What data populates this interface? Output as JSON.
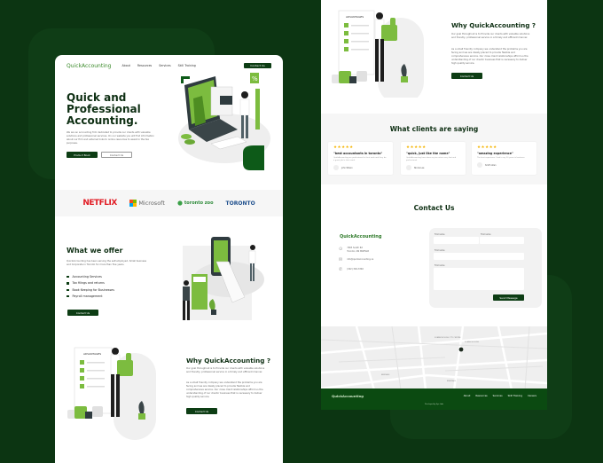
{
  "brand": "QuickAccounting",
  "nav": {
    "links": [
      "About",
      "Resources",
      "Services",
      "Skill Training"
    ],
    "contact_button": "Contact Us"
  },
  "hero": {
    "title": "Quick and Professional Accounting.",
    "paragraph": "We are an accounting firm dedicated to provide our clients with valuable solutions and professional services. On our website you will find information about our firm and external links to online resources to assist in the tax purposes.",
    "primary_button": "Product Book",
    "secondary_button": "Contact Us"
  },
  "clients_strip": {
    "logos": [
      "NETFLIX",
      "Microsoft",
      "toronto zoo",
      "TORONTO"
    ]
  },
  "offer": {
    "title": "What we offer",
    "paragraph": "QuickAccounting has been serving the self-employed, Small business and Corporate in Toronto for more than five years.",
    "items": [
      "Accounting Services",
      "Tax filings and returns",
      "Book Keeping for Businesses",
      "Payroll management"
    ],
    "button": "Contact Us"
  },
  "why": {
    "title": "Why QuickAccounting ?",
    "paragraph1": "Our goal throughout is to Provide our clients with valuable solutions and friendly, professional service in a timely and efficient manner.",
    "paragraph2": "As a small friendly company we understand the problems you are facing and we are ideally placed to provide flexible and comprehensive service. Our close client relationships afford us the understanding of our clients' business that is necessary to deliver high quality service.",
    "button": "Contact Us",
    "illustration_label": "ADVANTAGES"
  },
  "testimonials": {
    "title": "What clients are saying",
    "reviews": [
      {
        "stars": "★★★★★",
        "quote": "\"best accountants in toronto\"",
        "text": "QuickAccounting are professional in their work and they do a great job in their work.",
        "author": "John Wilson"
      },
      {
        "stars": "★★★★★",
        "quote": "\"quick, just like the name\"",
        "text": "QuickAccounting have done my tax return very fast and professional.",
        "author": "Nicole Lee"
      },
      {
        "stars": "★★★★★",
        "quote": "\"amazing experience\"",
        "text": "The best experience I had in my 20 years in business.",
        "author": "Smith Allen"
      }
    ]
  },
  "contact": {
    "title": "Contact Us",
    "brand": "QuickAccounting",
    "address_line1": "7063 South Rd",
    "address_line2": "Toronto, ON M4P5G8",
    "email": "info@quickaccounting.ca",
    "phone": "(342) 394-3340",
    "form": {
      "label_first": "First name",
      "label_last": "First name",
      "label_email": "First name",
      "label_message": "First name",
      "submit": "Send Message"
    }
  },
  "map": {
    "labels": [
      "SCARBOROUGH CITY CENTRE",
      "SCARBOROUGH",
      "BENDALE",
      "BIRKDALE"
    ]
  },
  "footer": {
    "brand": "QuickAccounting",
    "links": [
      "About",
      "Resources",
      "Services",
      "Skill Training",
      "Careers"
    ],
    "copyright": "Developed by Syn Labs"
  }
}
